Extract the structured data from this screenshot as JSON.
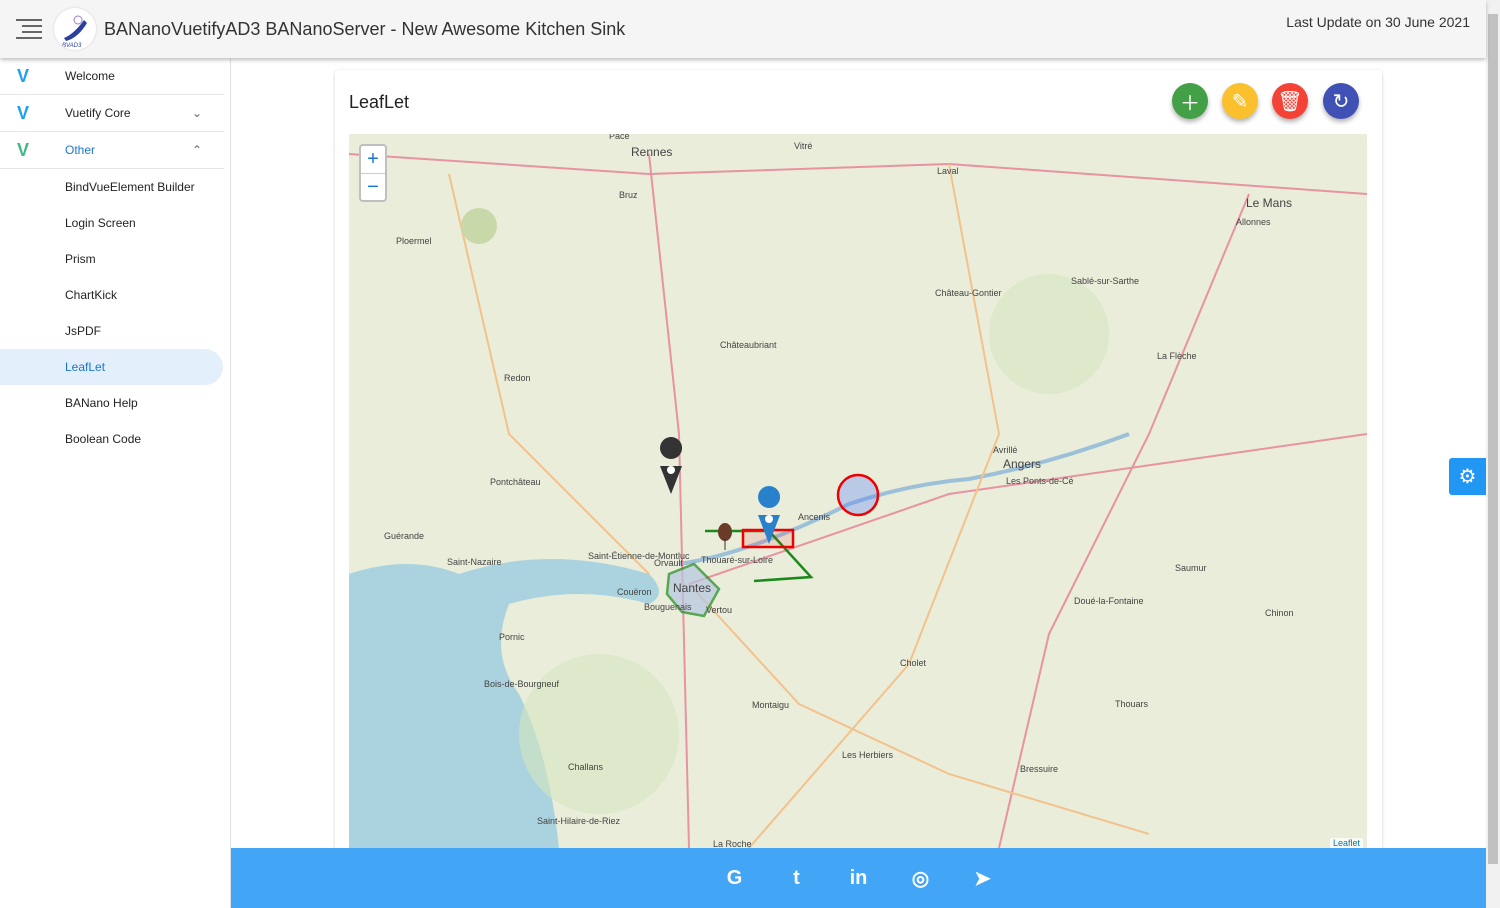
{
  "header": {
    "title": "BANanoVuetifyAD3 BANanoServer - New Awesome Kitchen Sink",
    "logo_text": "BVAD3",
    "last_update": "Last Update on 30 June 2021"
  },
  "sidebar": {
    "items": [
      {
        "label": "Welcome",
        "icon": "vuetify-logo-icon"
      },
      {
        "label": "Vuetify Core",
        "icon": "vuetify-logo-icon",
        "chevron": "down"
      },
      {
        "label": "Other",
        "icon": "vue-logo-icon",
        "chevron": "up"
      },
      {
        "label": "BindVueElement Builder"
      },
      {
        "label": "Login Screen"
      },
      {
        "label": "Prism"
      },
      {
        "label": "ChartKick"
      },
      {
        "label": "JsPDF"
      },
      {
        "label": "LeafLet",
        "active": true
      },
      {
        "label": "BANano Help"
      },
      {
        "label": "Boolean Code"
      }
    ]
  },
  "card": {
    "title": "LeafLet",
    "buttons": [
      {
        "icon": "plus-icon",
        "color": "#43a047"
      },
      {
        "icon": "pencil-icon",
        "color": "#fbc02d"
      },
      {
        "icon": "delete-icon",
        "color": "#f44336"
      },
      {
        "icon": "refresh-icon",
        "color": "#3f51b5"
      }
    ]
  },
  "map": {
    "zoom_in": "+",
    "zoom_out": "−",
    "attribution": "Leaflet",
    "places": [
      "Pace",
      "Rennes",
      "Vitré",
      "Bruz",
      "Laval",
      "Le Mans",
      "Allonnes",
      "Ploermel",
      "Château-Gontier",
      "Sablé-sur-Sarthe",
      "Châteaubriant",
      "La Flèche",
      "Redon",
      "Avrillé",
      "Angers",
      "Les Ponts-de-Cé",
      "Pontchâteau",
      "Ancenis",
      "Guérande",
      "Saint-Nazaire",
      "Saint-Étienne-de-Montluc",
      "Orvault",
      "Thouaré-sur-Loire",
      "Couëron",
      "Nantes",
      "Bouguenais",
      "Vertou",
      "Saumur",
      "Doué-la-Fontaine",
      "Chinon",
      "Pornic",
      "Cholet",
      "Bois-de-Bourgneuf",
      "Montaigu",
      "Thouars",
      "Les Herbiers",
      "Bressuire",
      "Challans",
      "Saint-Hilaire-de-Riez",
      "La Roche"
    ]
  },
  "footer": {
    "icons": [
      "google-icon",
      "twitter-icon",
      "linkedin-icon",
      "whatsapp-icon",
      "telegram-icon"
    ],
    "glyphs": [
      "G",
      "t",
      "in",
      "◎",
      "➤"
    ]
  },
  "colors": {
    "accent": "#1976d2",
    "footer": "#42a5f5"
  }
}
